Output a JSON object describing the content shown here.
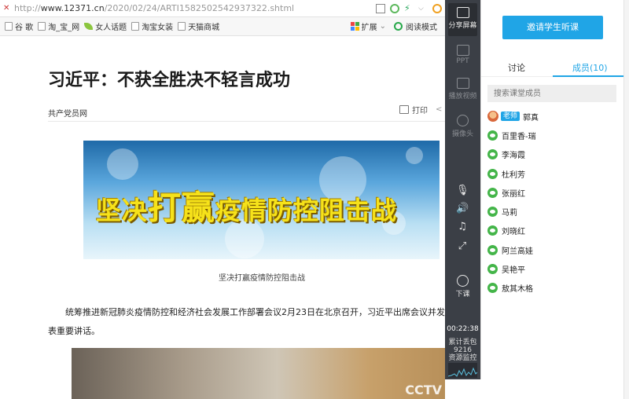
{
  "browser": {
    "url_prefix": "http://",
    "url_domain": "www.12371.cn",
    "url_path": "/2020/02/24/ARTI1582502542937322.shtml",
    "bookmarks": [
      "谷 歌",
      "淘_宝_网",
      "女人话题",
      "淘宝女装",
      "天猫商城"
    ],
    "extensions_label": "扩展",
    "reading_mode_label": "阅读模式"
  },
  "article": {
    "title": "习近平：不获全胜决不轻言成功",
    "source": "共产党员网",
    "print_label": "打印",
    "banner_text_pre": "坚决",
    "banner_text_big": "打赢",
    "banner_text_post": "疫情防控阻击战",
    "caption": "坚决打赢疫情防控阻击战",
    "paragraph": "统筹推进新冠肺炎疫情防控和经济社会发展工作部署会议2月23日在北京召开，习近平出席会议并发表重要讲话。",
    "video_logo": "CCTV"
  },
  "toolbar": {
    "share_screen": "分享屏幕",
    "ppt": "PPT",
    "play_video": "播放视频",
    "camera": "摄像头",
    "end_class": "下课",
    "timer": "00:22:38",
    "sent_packets_label": "累计丢包",
    "sent_packets_value": "9216",
    "resource_monitor": "资源监控"
  },
  "panel": {
    "invite_button": "邀请学生听课",
    "tab_discussion": "讨论",
    "tab_members": "成员(10)",
    "search_placeholder": "搜索课堂成员",
    "teacher_badge": "老师",
    "members": [
      "郭真",
      "百里香-瑞",
      "李海霞",
      "杜利芳",
      "张丽红",
      "马莉",
      "刘晓红",
      "阿兰高娃",
      "吴艳平",
      "敖其木格"
    ]
  }
}
